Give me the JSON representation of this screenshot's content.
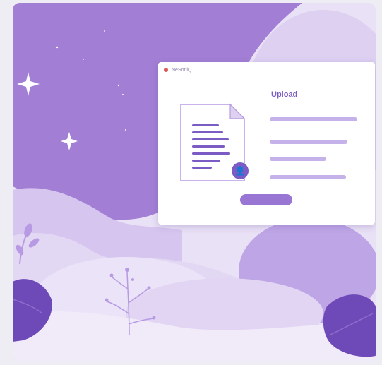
{
  "window": {
    "app_title": "NeSoniQ",
    "heading": "Upload",
    "badge_icon": "person-icon",
    "upload_button_label": ""
  },
  "colors": {
    "background": "#eeedf3",
    "sky": "#a27fd5",
    "accent": "#7b5bc4",
    "line": "#c5b2ea",
    "close_dot": "#e05a5a"
  }
}
